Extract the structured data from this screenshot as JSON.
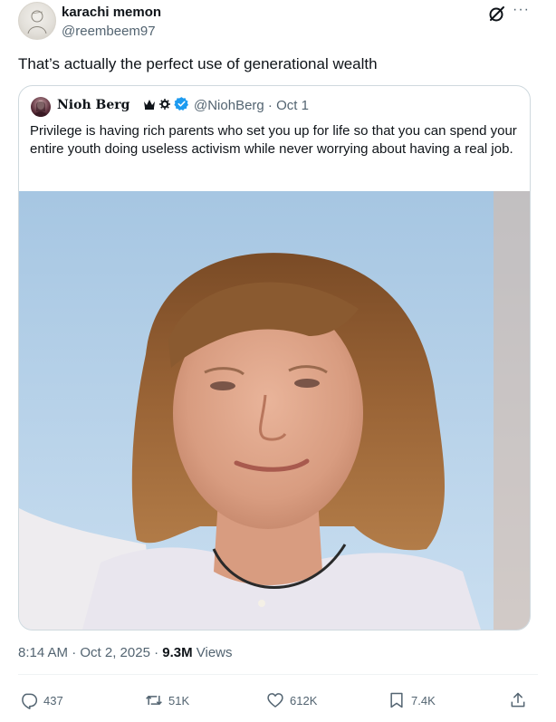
{
  "author": {
    "display_name": "karachi memon",
    "handle": "@reembeem97",
    "avatar": "avatar"
  },
  "header_icons": [
    "grok-icon",
    "more-icon"
  ],
  "more_label": "···",
  "tweet_text": "That’s actually the perfect use of generational wealth",
  "quoted": {
    "display_name": "Nioh Berg",
    "badges": [
      "crown-icon",
      "gear-icon",
      "verified-badge-icon"
    ],
    "handle_time": "@NiohBerg · Oct 1",
    "text": "Privilege is having rich parents who set you up for life so that you can spend your entire youth doing useless activism while never worrying about having a real job.",
    "image": "photo"
  },
  "meta": {
    "time_date": "8:14 AM · Oct 2, 2025 · ",
    "views_count": "9.3M",
    "views_label": " Views"
  },
  "actions": {
    "replies": "437",
    "reposts": "51K",
    "likes": "612K",
    "bookmarks": "7.4K"
  },
  "colors": {
    "text": "#0f1419",
    "secondary": "#536471",
    "border": "#cfd9de",
    "verified": "#1d9bf0"
  }
}
